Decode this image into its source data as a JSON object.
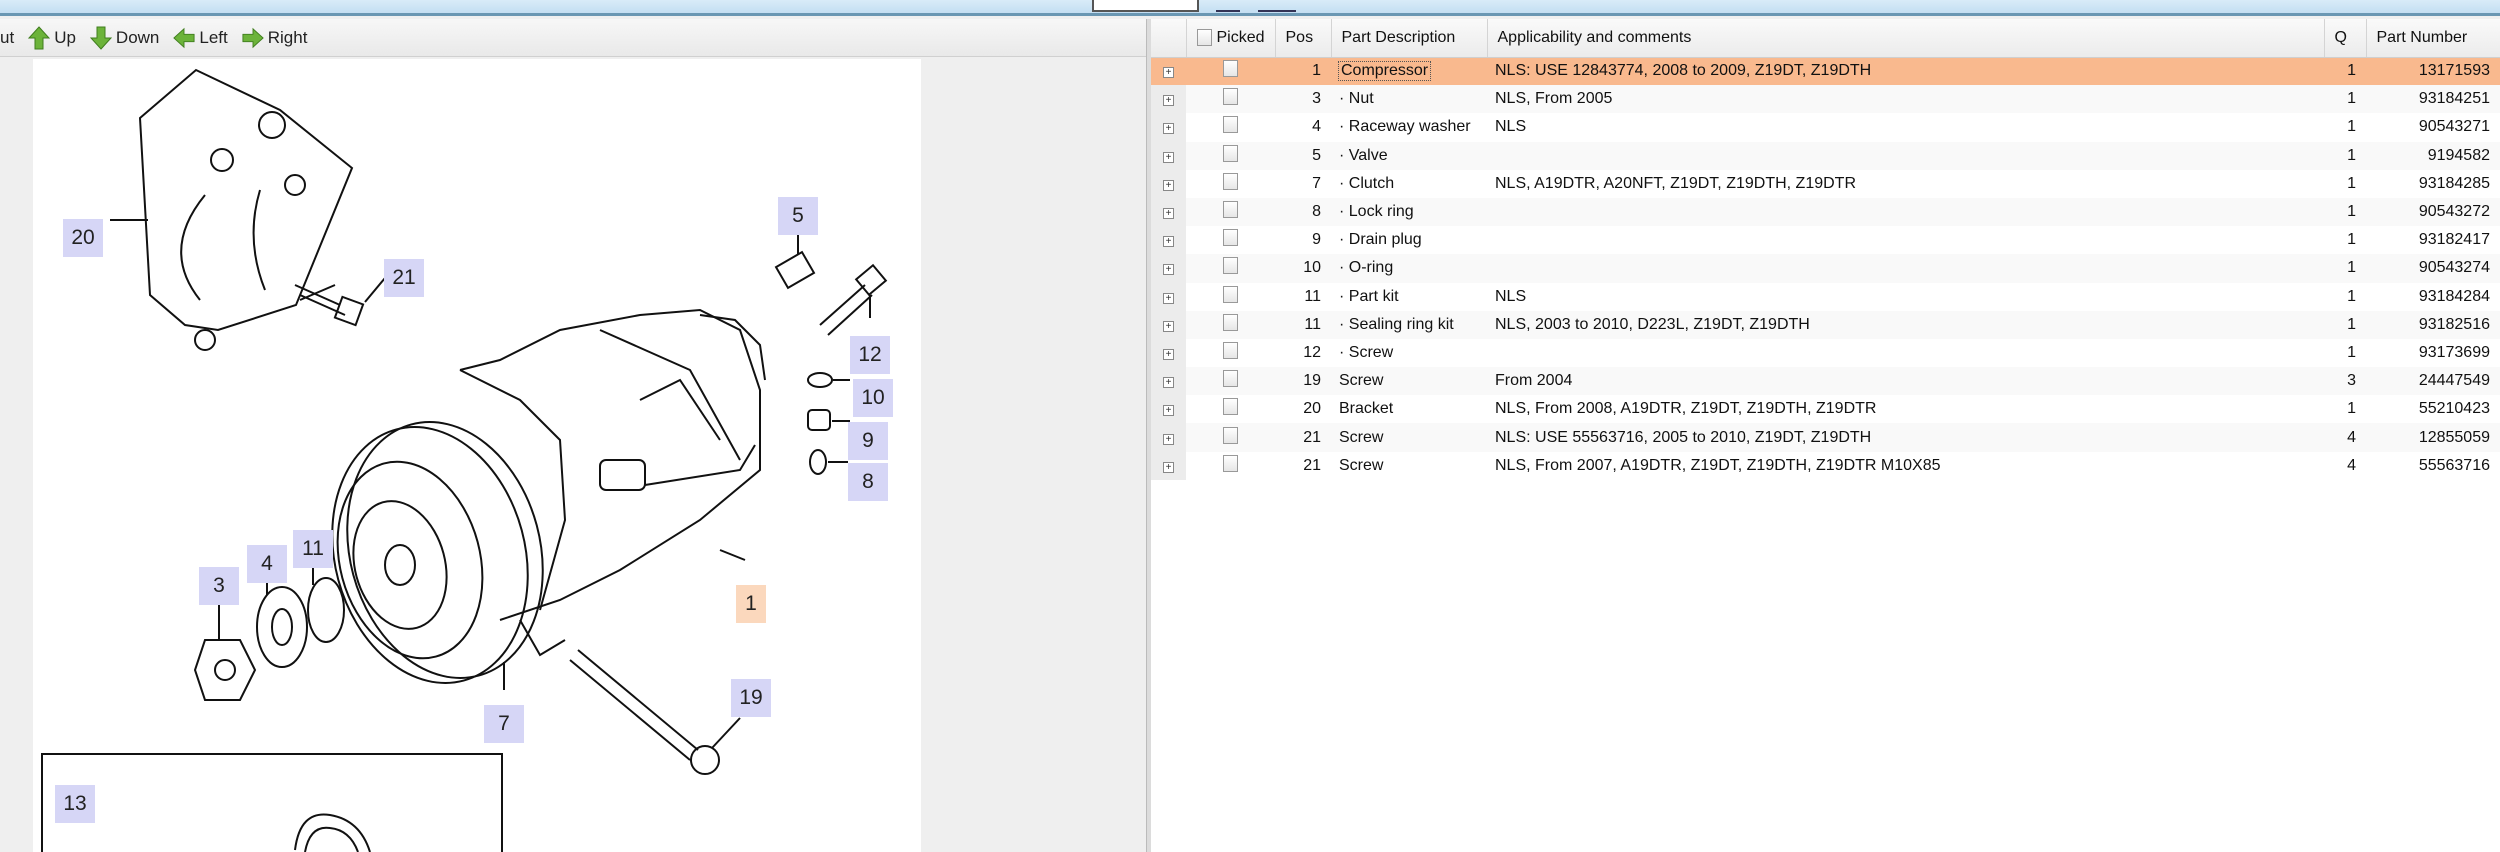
{
  "toolbar": {
    "zoom_out_label": "ut",
    "up_label": "Up",
    "down_label": "Down",
    "left_label": "Left",
    "right_label": "Right"
  },
  "diagram": {
    "callouts": [
      "20",
      "21",
      "5",
      "12",
      "10",
      "9",
      "8",
      "3",
      "4",
      "11",
      "1",
      "7",
      "19",
      "13"
    ],
    "selected": "1"
  },
  "table": {
    "headers": {
      "picked": "Picked",
      "pos": "Pos",
      "desc": "Part Description",
      "comments": "Applicability and comments",
      "q": "Q",
      "part_number": "Part Number"
    },
    "rows": [
      {
        "pos": "1",
        "desc": "Compressor",
        "comments": "NLS: USE 12843774, 2008 to 2009, Z19DT, Z19DTH",
        "q": "1",
        "part_number": "13171593"
      },
      {
        "pos": "3",
        "desc": "· Nut",
        "comments": "NLS, From 2005",
        "q": "1",
        "part_number": "93184251"
      },
      {
        "pos": "4",
        "desc": "· Raceway washer",
        "comments": "NLS",
        "q": "1",
        "part_number": "90543271"
      },
      {
        "pos": "5",
        "desc": "· Valve",
        "comments": "",
        "q": "1",
        "part_number": "9194582"
      },
      {
        "pos": "7",
        "desc": "· Clutch",
        "comments": "NLS, A19DTR, A20NFT, Z19DT, Z19DTH, Z19DTR",
        "q": "1",
        "part_number": "93184285"
      },
      {
        "pos": "8",
        "desc": "· Lock ring",
        "comments": "",
        "q": "1",
        "part_number": "90543272"
      },
      {
        "pos": "9",
        "desc": "· Drain plug",
        "comments": "",
        "q": "1",
        "part_number": "93182417"
      },
      {
        "pos": "10",
        "desc": "· O-ring",
        "comments": "",
        "q": "1",
        "part_number": "90543274"
      },
      {
        "pos": "11",
        "desc": "· Part kit",
        "comments": "NLS",
        "q": "1",
        "part_number": "93184284"
      },
      {
        "pos": "11",
        "desc": "· Sealing ring kit",
        "comments": "NLS, 2003 to 2010, D223L, Z19DT, Z19DTH",
        "q": "1",
        "part_number": "93182516"
      },
      {
        "pos": "12",
        "desc": "· Screw",
        "comments": "",
        "q": "1",
        "part_number": "93173699"
      },
      {
        "pos": "19",
        "desc": "Screw",
        "comments": "From 2004",
        "q": "3",
        "part_number": "24447549"
      },
      {
        "pos": "20",
        "desc": "Bracket",
        "comments": "NLS, From 2008, A19DTR, Z19DT, Z19DTH, Z19DTR",
        "q": "1",
        "part_number": "55210423"
      },
      {
        "pos": "21",
        "desc": "Screw",
        "comments": "NLS: USE 55563716, 2005 to 2010, Z19DT, Z19DTH",
        "q": "4",
        "part_number": "12855059"
      },
      {
        "pos": "21",
        "desc": "Screw",
        "comments": "NLS, From 2007, A19DTR, Z19DT, Z19DTH, Z19DTR M10X85",
        "q": "4",
        "part_number": "55563716"
      }
    ],
    "selected_row": 0
  },
  "colors": {
    "selected_row": "#f9b98e",
    "callout": "#d6d6f6",
    "callout_selected": "#fbd8bd",
    "arrow_green": "#6cb33a"
  }
}
